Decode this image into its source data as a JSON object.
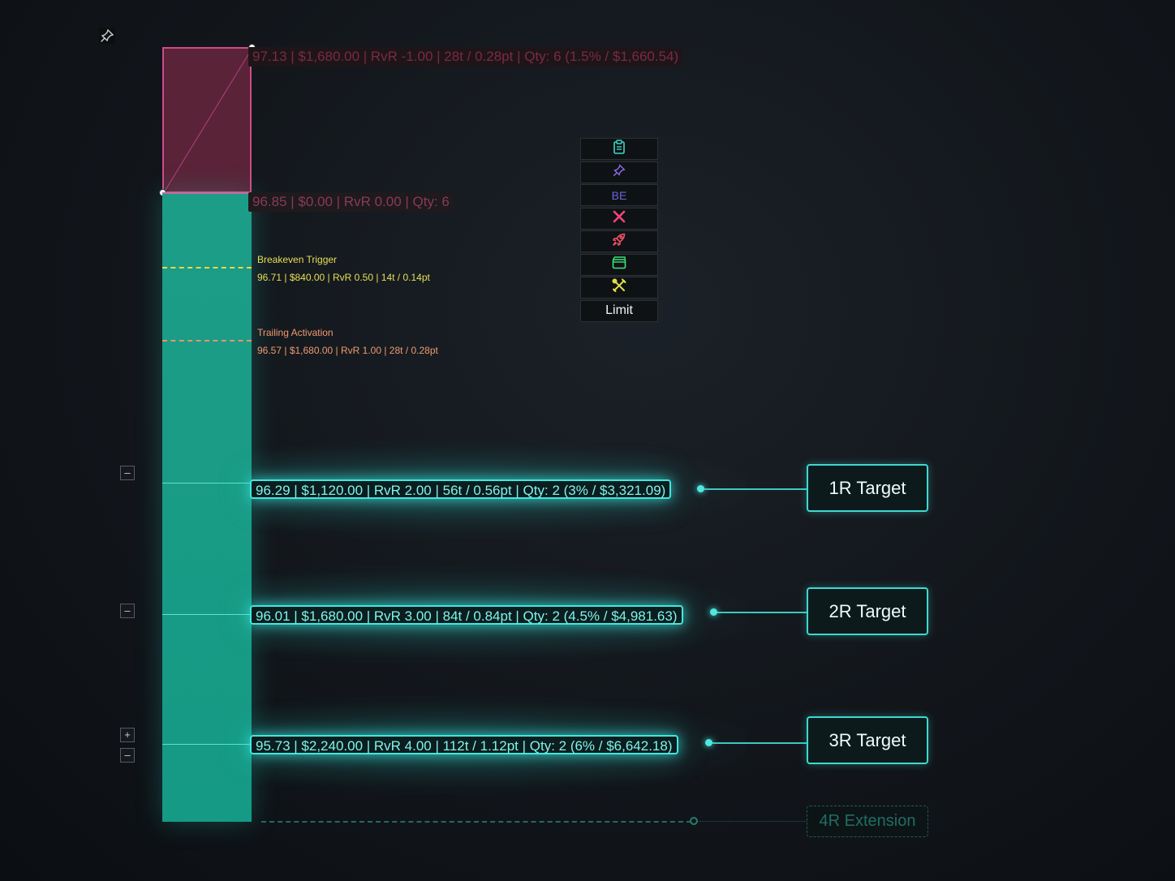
{
  "stop": {
    "label": "97.13 | $1,680.00 | RvR -1.00 | 28t / 0.28pt | Qty: 6 (1.5% / $1,660.54)"
  },
  "entry": {
    "label": "96.85 | $0.00 | RvR 0.00 | Qty: 6"
  },
  "breakeven": {
    "title": "Breakeven Trigger",
    "info": "96.71 | $840.00 | RvR 0.50 | 14t / 0.14pt"
  },
  "trailing": {
    "title": "Trailing Activation",
    "info": "96.57 | $1,680.00 | RvR 1.00 | 28t / 0.28pt"
  },
  "targets": [
    {
      "label": "96.29 | $1,120.00 | RvR 2.00 | 56t / 0.56pt | Qty: 2 (3% / $3,321.09)",
      "button": "1R Target"
    },
    {
      "label": "96.01 | $1,680.00 | RvR 3.00 | 84t / 0.84pt | Qty: 2 (4.5% / $4,981.63)",
      "button": "2R Target"
    },
    {
      "label": "95.73 | $2,240.00 | RvR 4.00 | 112t / 1.12pt | Qty: 2 (6% / $6,642.18)",
      "button": "3R Target"
    }
  ],
  "extension": {
    "button": "4R Extension"
  },
  "controls": {
    "minus": "–",
    "plus": "+"
  },
  "toolbar": {
    "be_label": "BE",
    "limit_label": "Limit",
    "icons": [
      "clipboard-icon",
      "pin-icon",
      "be-text",
      "close-icon",
      "rocket-icon",
      "film-icon",
      "tools-icon",
      "limit-text"
    ]
  },
  "colors": {
    "stop_fill": "#5a2338",
    "stop_border": "#d04a8a",
    "target_fill": "#1a9c86",
    "target_glow": "#3ee8df",
    "breakeven": "#e8df55",
    "trailing": "#ef9a6d"
  }
}
